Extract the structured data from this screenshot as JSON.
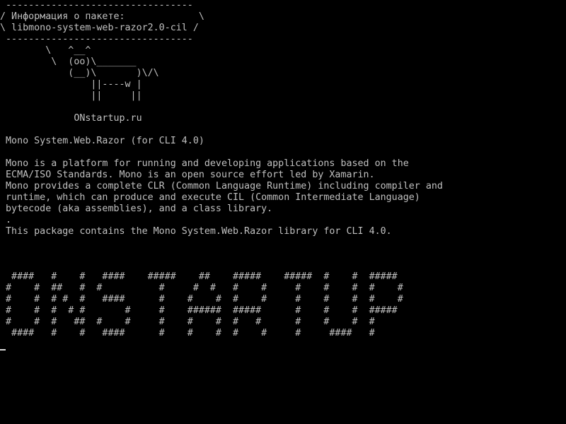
{
  "terminal": {
    "colors": {
      "background": "#000000",
      "foreground": "#c0c0c0"
    },
    "lines": [
      " ---------------------------------",
      "/ Информация о пакете:             \\",
      "\\ libmono-system-web-razor2.0-cil /",
      " ---------------------------------",
      "        \\   ^__^",
      "         \\  (oo)\\_______",
      "            (__)\\       )\\/\\",
      "                ||----w |",
      "                ||     ||",
      "",
      "             ONstartup.ru",
      "",
      " Mono System.Web.Razor (for CLI 4.0)",
      "",
      " Mono is a platform for running and developing applications based on the",
      " ECMA/ISO Standards. Mono is an open source effort led by Xamarin.",
      " Mono provides a complete CLR (Common Language Runtime) including compiler and",
      " runtime, which can produce and execute CIL (Common Intermediate Language)",
      " bytecode (aka assemblies), and a class library.",
      " .",
      " This package contains the Mono System.Web.Razor library for CLI 4.0.",
      "",
      "",
      "",
      "  ####   #    #   ####    #####    ##    #####    #####  #    #  #####",
      " #    #  ##   #  #          #     #  #   #    #     #    #    #  #    #",
      " #    #  # #  #   ####      #    #    #  #    #     #    #    #  #    #",
      " #    #  #  # #       #     #    ######  #####      #    #    #  #####",
      " #    #  #   ##  #    #     #    #    #  #   #      #    #    #  #",
      "  ####   #    #   ####      #    #    #  #    #     #     ####   #",
      ""
    ]
  }
}
